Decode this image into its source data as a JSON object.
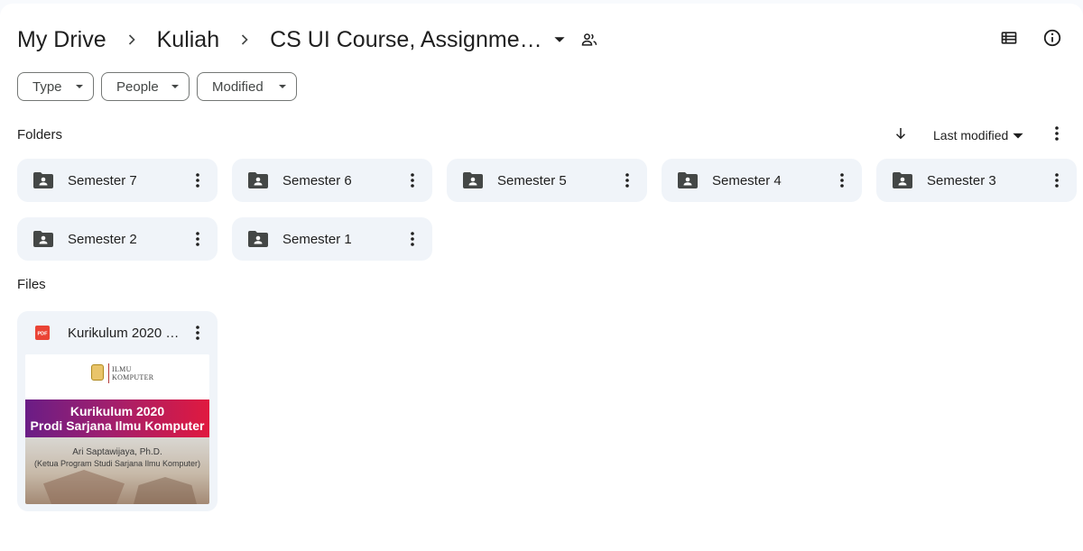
{
  "breadcrumb": {
    "items": [
      "My Drive",
      "Kuliah"
    ],
    "current": "CS UI Course, Assignme…"
  },
  "header": {
    "icons": [
      "shared-people-icon",
      "list-view-icon",
      "info-icon"
    ]
  },
  "filters": [
    {
      "label": "Type"
    },
    {
      "label": "People"
    },
    {
      "label": "Modified"
    }
  ],
  "folders_section": {
    "title": "Folders",
    "sort_field": "Last modified",
    "sort_direction": "descending"
  },
  "folders": [
    {
      "name": "Semester 7"
    },
    {
      "name": "Semester 6"
    },
    {
      "name": "Semester 5"
    },
    {
      "name": "Semester 4"
    },
    {
      "name": "Semester 3"
    },
    {
      "name": "Semester 2"
    },
    {
      "name": "Semester 1"
    }
  ],
  "files_section": {
    "title": "Files"
  },
  "files": [
    {
      "name": "Kurikulum 2020 …",
      "type": "PDF",
      "thumbnail": {
        "logo_text_top": "Ilmu",
        "logo_text_bottom": "Komputer",
        "banner_line1": "Kurikulum 2020",
        "banner_line2": "Prodi Sarjana Ilmu Komputer",
        "author": "Ari Saptawijaya, Ph.D.",
        "role": "(Ketua Program Studi Sarjana Ilmu Komputer)"
      }
    }
  ],
  "colors": {
    "background": "#f8fafd",
    "card": "#f0f4f9",
    "text": "#1f1f1f",
    "icon": "#444746",
    "pdf_red": "#ea4335"
  }
}
